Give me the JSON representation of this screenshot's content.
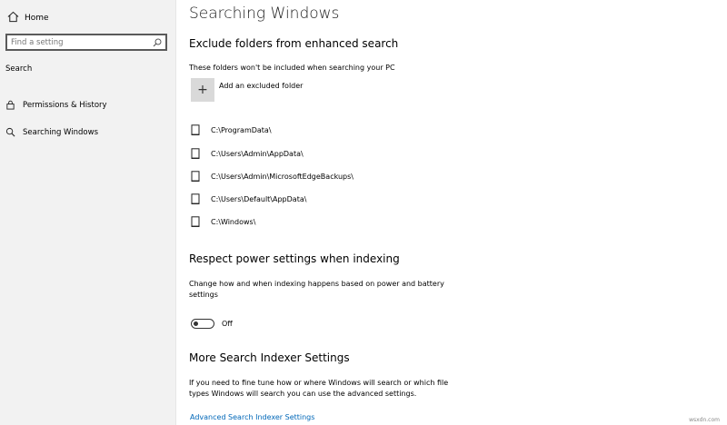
{
  "sidebar": {
    "home_label": "Home",
    "search_placeholder": "Find a setting",
    "section_label": "Search",
    "items": [
      {
        "label": "Permissions & History",
        "icon": "lock-icon"
      },
      {
        "label": "Searching Windows",
        "icon": "search-icon"
      }
    ]
  },
  "main": {
    "title": "Searching Windows",
    "exclude": {
      "heading": "Exclude folders from enhanced search",
      "description": "These folders won't be included when searching your PC",
      "add_label": "Add an excluded folder",
      "folders": [
        "C:\\ProgramData\\",
        "C:\\Users\\Admin\\AppData\\",
        "C:\\Users\\Admin\\MicrosoftEdgeBackups\\",
        "C:\\Users\\Default\\AppData\\",
        "C:\\Windows\\"
      ]
    },
    "power": {
      "heading": "Respect power settings when indexing",
      "description": "Change how and when indexing happens based on power and battery settings",
      "toggle_state": "Off"
    },
    "indexer": {
      "heading": "More Search Indexer Settings",
      "description": "If you need to fine tune how or where Windows will search or which file types Windows will search you can use the advanced settings.",
      "link_label": "Advanced Search Indexer Settings"
    }
  },
  "watermark": "wsxdn.com",
  "colors": {
    "accent": "#0067b8",
    "sidebar_bg": "#f2f2f2"
  }
}
